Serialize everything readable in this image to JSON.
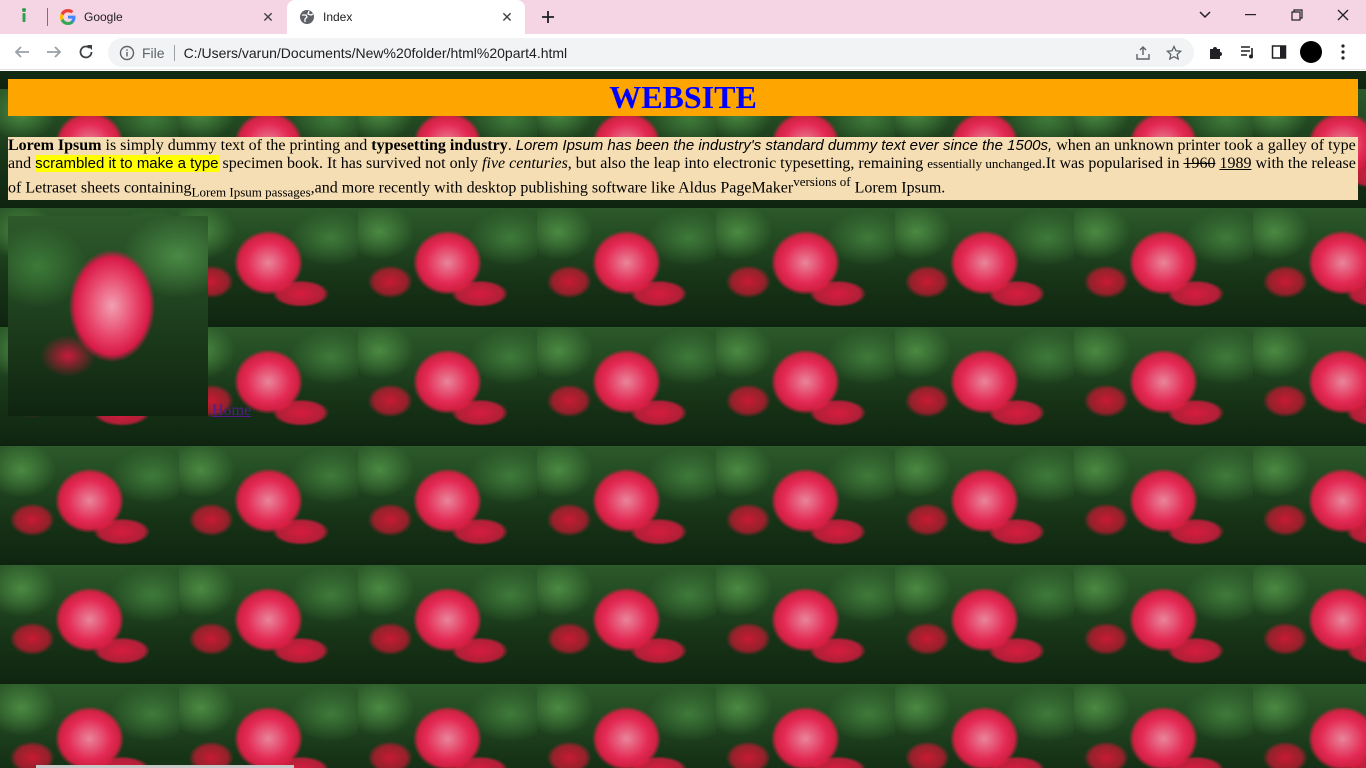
{
  "browser": {
    "tabs": [
      {
        "title": "Google",
        "favicon": "google-g-icon"
      },
      {
        "title": "Index",
        "favicon": "globe-icon"
      }
    ],
    "new_tab_label": "+",
    "address": {
      "scheme": "File",
      "url": "C:/Users/varun/Documents/New%20folder/html%20part4.html"
    },
    "colors": {
      "tabstrip": "#f5d4e4",
      "omnibox": "#f1f3f4"
    }
  },
  "page": {
    "header": "WEBSITE",
    "colors": {
      "header_bg": "#ffa500",
      "header_text": "#0000ff",
      "intro_bg": "#f5deb3",
      "highlight": "#ffff00"
    },
    "intro": {
      "p1_bold": "Lorem Ipsum",
      "p2": " is simply dummy text of the printing and ",
      "p3_bold": "typesetting industry",
      "p4": ". ",
      "p5_italic": "Lorem Ipsum has been the industry's standard dummy text ever since the 1500s,",
      "p6": " when an unknown printer took a galley of type and ",
      "p7_highlight": "scrambled it to make a type",
      "p8": " specimen book. It has survived not only ",
      "p9_italic": "five centuries",
      "p10": ", but also the leap into electronic typesetting, remaining ",
      "p11_small": "essentially unchanged",
      "p12": ".It was popularised in ",
      "p13_strike": "1960",
      "p14": " ",
      "p15_underline": "1989",
      "p16": " with the release of Letraset sheets containing",
      "p17_sub": "Lorem Ipsum passages",
      "p18": ",and more recently with desktop publishing software like Aldus PageMaker",
      "p19_sup": "versions of",
      "p20": " Lorem Ipsum."
    },
    "home_link": "Home"
  }
}
